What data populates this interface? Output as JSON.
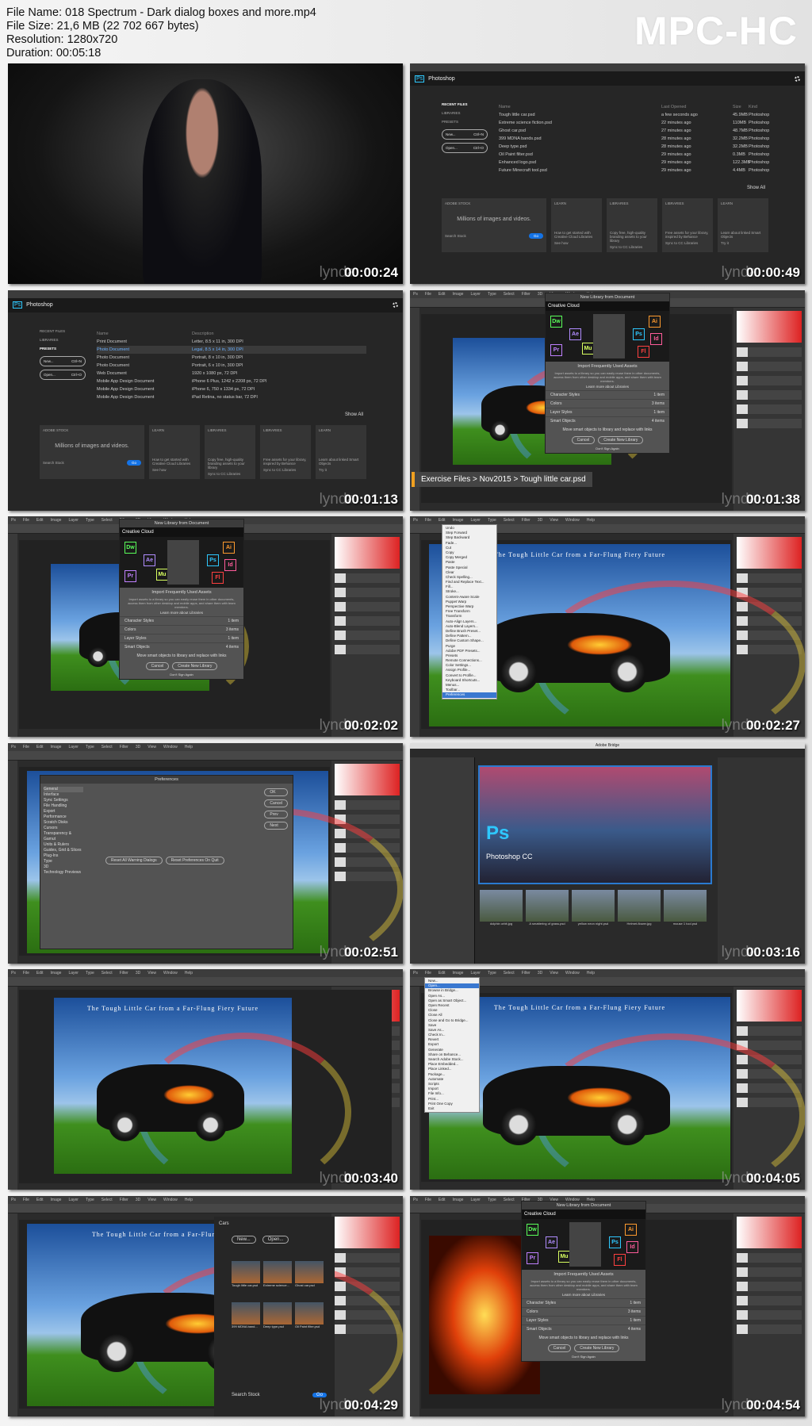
{
  "info": {
    "file_name": "File Name: 018 Spectrum - Dark dialog boxes and more.mp4",
    "file_size": "File Size: 21,6 MB (22 702 667 bytes)",
    "resolution": "Resolution: 1280x720",
    "duration": "Duration: 00:05:18"
  },
  "logo": "MPC-HC",
  "watermark": "lynda",
  "menu": [
    "Ps",
    "File",
    "Edit",
    "Image",
    "Layer",
    "Type",
    "Select",
    "Filter",
    "3D",
    "View",
    "Window",
    "Help"
  ],
  "canvas_title": "The Tough Little Car from a Far-Flung Fiery Future",
  "home": {
    "app": "Photoshop",
    "sidebar": [
      "RECENT FILES",
      "LIBRARIES",
      "PRESETS"
    ],
    "new": "New...",
    "new_sc": "Ctrl+N",
    "open": "Open...",
    "open_sc": "Ctrl+O",
    "headers": [
      "Name",
      "Last Opened",
      "Size",
      "Kind"
    ],
    "files": [
      [
        "Tough little car.psd",
        "a few seconds ago",
        "45.9MB",
        "Photoshop"
      ],
      [
        "Extreme science fiction.psd",
        "22 minutes ago",
        "110MB",
        "Photoshop"
      ],
      [
        "Ghost car.psd",
        "27 minutes ago",
        "48.7MB",
        "Photoshop"
      ],
      [
        "399 MDNA bands.psd",
        "28 minutes ago",
        "32.2MB",
        "Photoshop"
      ],
      [
        "Deep type.psd",
        "28 minutes ago",
        "32.2MB",
        "Photoshop"
      ],
      [
        "Oil Paint filter.psd",
        "29 minutes ago",
        "0.3MB",
        "Photoshop"
      ],
      [
        "Enhanced logo.psd",
        "29 minutes ago",
        "122.3MB",
        "Photoshop"
      ],
      [
        "Future Minecraft tool.psd",
        "29 minutes ago",
        "4.4MB",
        "Photoshop"
      ]
    ],
    "show_all": "Show All",
    "stock_title": "ADOBE STOCK",
    "stock_text": "Millions of images and videos.",
    "search": "Search Stock",
    "go": "Go",
    "cards": [
      [
        "LEARN",
        "How to get started with Creative Cloud Libraries",
        "See how"
      ],
      [
        "LIBRARIES",
        "Copy free, high-quality branding assets to your library",
        "Sync to CC Libraries"
      ],
      [
        "LIBRARIES",
        "Free assets for your library, inspired by Behance",
        "Sync to CC Libraries"
      ],
      [
        "LEARN",
        "Learn about linked Smart Objects",
        "Try it"
      ]
    ]
  },
  "presets": {
    "headers": [
      "Name",
      "Description"
    ],
    "items": [
      [
        "Print Document",
        "Letter, 8.5 x 11 in, 300 DPI"
      ],
      [
        "Photo Document",
        "Legal, 8.5 x 14 in, 300 DPI"
      ],
      [
        "Photo Document",
        "Portrait, 8 x 10 in, 300 DPI"
      ],
      [
        "Photo Document",
        "Portrait, 6 x 10 in, 300 DPI"
      ],
      [
        "Web Document",
        "1920 x 1080 px, 72 DPI"
      ],
      [
        "Mobile App Design Document",
        "iPhone 6 Plus, 1242 x 2208 px, 72 DPI"
      ],
      [
        "Mobile App Design Document",
        "iPhone 6, 750 x 1334 px, 72 DPI"
      ],
      [
        "Mobile App Design Document",
        "iPad Retina, no status bar, 72 DPI"
      ]
    ]
  },
  "dialog": {
    "title": "New Library from Document",
    "cc": "Creative Cloud",
    "heading": "Import Frequently Used Assets",
    "body": "Import assets to a library so you can easily reuse them in other documents, access them from other desktop and mobile apps, and share them with team members.",
    "learn": "Learn more about Libraries",
    "items": [
      [
        "Character Styles",
        "1 item"
      ],
      [
        "Colors",
        "3 items"
      ],
      [
        "Layer Styles",
        "1 item"
      ],
      [
        "Smart Objects",
        "4 items"
      ]
    ],
    "move": "Move smart objects to library and replace with links",
    "cancel": "Cancel",
    "create": "Create New Library",
    "signin": "Don't Sign Again",
    "apps": [
      [
        "Dw",
        "#5aff5a"
      ],
      [
        "Ae",
        "#b08cff"
      ],
      [
        "Pr",
        "#c080ff"
      ],
      [
        "Mu",
        "#d8ff60"
      ],
      [
        "Ai",
        "#ff9a2e"
      ],
      [
        "Ps",
        "#2ec8ff"
      ],
      [
        "Id",
        "#ff5c9a"
      ],
      [
        "Fl",
        "#ff4040"
      ]
    ]
  },
  "crumb": "Exercise Files > Nov2015 > Tough little car.psd",
  "edit_menu": [
    "Undo",
    "Step Forward",
    "Step Backward",
    "Fade...",
    "Cut",
    "Copy",
    "Copy Merged",
    "Paste",
    "Paste Special",
    "Clear",
    "Check Spelling...",
    "Find and Replace Text...",
    "Fill...",
    "Stroke...",
    "Content-Aware Scale",
    "Puppet Warp",
    "Perspective Warp",
    "Free Transform",
    "Transform",
    "Auto-Align Layers...",
    "Auto-Blend Layers...",
    "Define Brush Preset...",
    "Define Pattern...",
    "Define Custom Shape...",
    "Purge",
    "Adobe PDF Presets...",
    "Presets",
    "Remote Connections...",
    "Color Settings...",
    "Assign Profile...",
    "Convert to Profile...",
    "Keyboard Shortcuts...",
    "Menus...",
    "Toolbar...",
    "Preferences"
  ],
  "file_menu": [
    "New...",
    "Open...",
    "Browse in Bridge...",
    "Open As...",
    "Open as Smart Object...",
    "Open Recent",
    "Close",
    "Close All",
    "Close and Go to Bridge...",
    "Save",
    "Save As...",
    "Check In...",
    "Revert",
    "Export",
    "Generate",
    "Share on Behance...",
    "Search Adobe Stock...",
    "Place Embedded...",
    "Place Linked...",
    "Package...",
    "Automate",
    "Scripts",
    "Import",
    "File Info...",
    "Print...",
    "Print One Copy",
    "Exit"
  ],
  "prefs": {
    "title": "Preferences",
    "sections": [
      "General",
      "Interface",
      "Sync Settings",
      "File Handling",
      "Export",
      "Performance",
      "Scratch Disks",
      "Cursors",
      "Transparency & Gamut",
      "Units & Rulers",
      "Guides, Grid & Slices",
      "Plug-Ins",
      "Type",
      "3D",
      "Technology Previews"
    ],
    "ok": "OK",
    "cancel": "Cancel",
    "prev": "Prev",
    "next": "Next",
    "reset": "Reset All Warning Dialogs",
    "reset_start": "Reset Preferences On Quit"
  },
  "bridge": {
    "title": "Adobe Bridge",
    "ps": "Ps",
    "brand": "Photoshop CC",
    "thumbs": [
      "dolphin orbit.jpg",
      "A smattering of grass.psd",
      "yellow neon night.psd",
      "Helmet-flower.jpg",
      "mouse 1 tool.psd"
    ]
  },
  "start": {
    "back": "Cars",
    "new": "New...",
    "open": "Open...",
    "files": [
      "Tough little car.psd",
      "Extreme science...",
      "Ghost car.psd",
      "399 MDNA band...",
      "Deep type.psd",
      "Oil Paint filter.psd"
    ],
    "search": "Search Stock",
    "go": "Go"
  },
  "frames": [
    {
      "type": "video",
      "time": "00:00:24"
    },
    {
      "type": "home",
      "time": "00:00:49"
    },
    {
      "type": "presets",
      "time": "00:01:13"
    },
    {
      "type": "dialog",
      "time": "00:01:38",
      "crumb": true
    },
    {
      "type": "dialog",
      "time": "00:02:02"
    },
    {
      "type": "edit",
      "time": "00:02:27"
    },
    {
      "type": "prefs",
      "time": "00:02:51"
    },
    {
      "type": "bridge",
      "time": "00:03:16"
    },
    {
      "type": "full",
      "time": "00:03:40"
    },
    {
      "type": "file",
      "time": "00:04:05"
    },
    {
      "type": "start",
      "time": "00:04:29"
    },
    {
      "type": "dialog",
      "time": "00:04:54",
      "fire": true
    }
  ]
}
